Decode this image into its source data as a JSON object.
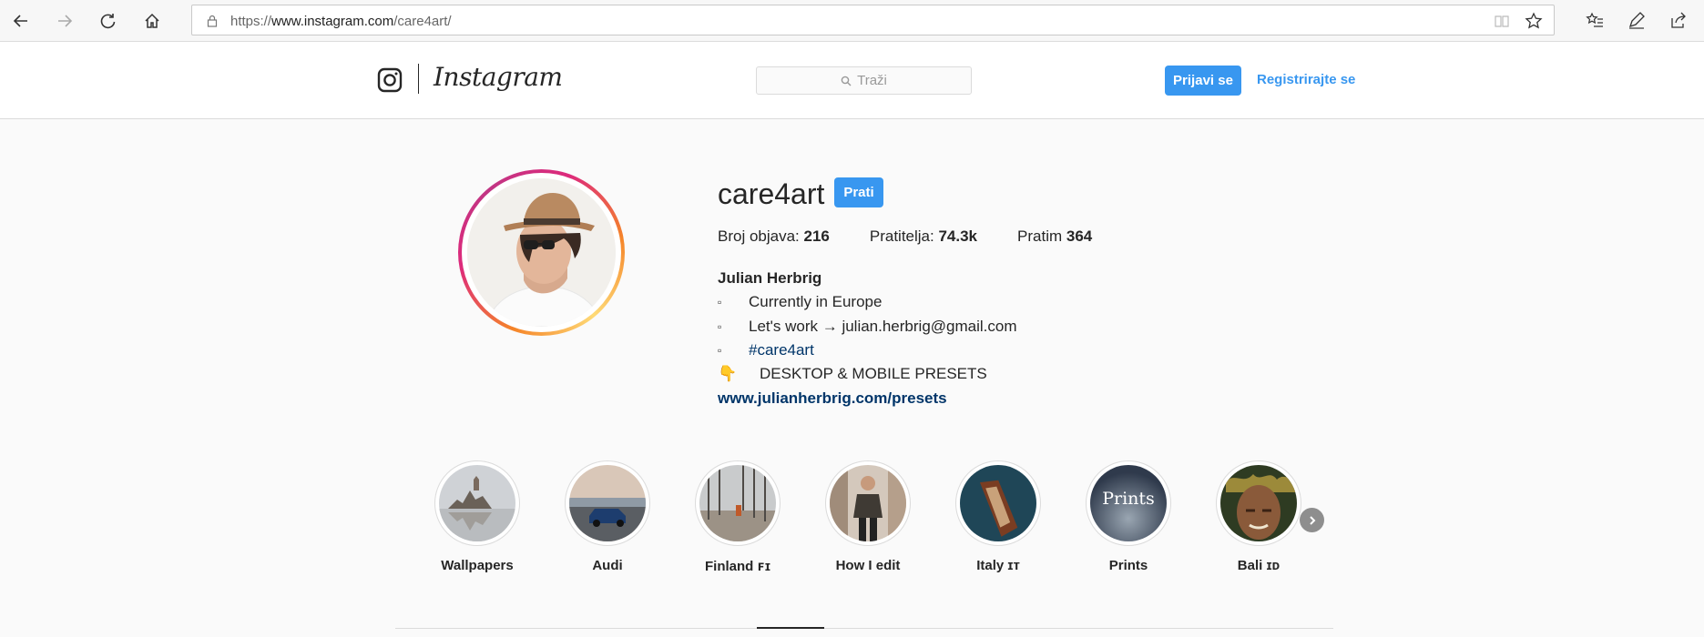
{
  "browser": {
    "url_prefix": "https://",
    "url_host": "www.instagram.com",
    "url_path": "/care4art/",
    "icons": [
      "back-icon",
      "forward-icon",
      "refresh-icon",
      "home-icon",
      "lock-icon",
      "reading-view-icon",
      "favorite-star-icon",
      "favorites-hub-icon",
      "pen-icon",
      "share-icon"
    ]
  },
  "header": {
    "brand": "Instagram",
    "search_placeholder": "Traži",
    "login_label": "Prijavi se",
    "register_label": "Registrirajte se",
    "accent": "#3897f0"
  },
  "profile": {
    "username": "care4art",
    "follow_label": "Prati",
    "stats": [
      {
        "label": "Broj objava: ",
        "value": "216"
      },
      {
        "label": "Pratitelja: ",
        "value": "74.3k"
      },
      {
        "label": "Pratim ",
        "value": "364"
      }
    ],
    "full_name": "Julian Herbrig",
    "bio": [
      {
        "bullet": "▫",
        "text": "Currently in Europe"
      },
      {
        "bullet": "▫",
        "text": "Let's work → julian.herbrig@gmail.com"
      },
      {
        "bullet": "▫",
        "text": "#care4art"
      },
      {
        "bullet": "👇",
        "text": "DESKTOP & MOBILE PRESETS"
      }
    ],
    "link": "www.julianherbrig.com/presets"
  },
  "highlights": [
    {
      "label": "Wallpapers"
    },
    {
      "label": "Audi"
    },
    {
      "label": "Finland 🇫🇮"
    },
    {
      "label": "How I edit"
    },
    {
      "label": "Italy 🇮🇹"
    },
    {
      "label": "Prints"
    },
    {
      "label": "Bali 🇮🇩"
    }
  ],
  "highlight_labels_display": [
    "Wallpapers",
    "Audi",
    "Finland ꜰɪ",
    "How I edit",
    "Italy ɪᴛ",
    "Prints",
    "Bali ɪᴅ"
  ],
  "prints_cover_text": "Prints"
}
